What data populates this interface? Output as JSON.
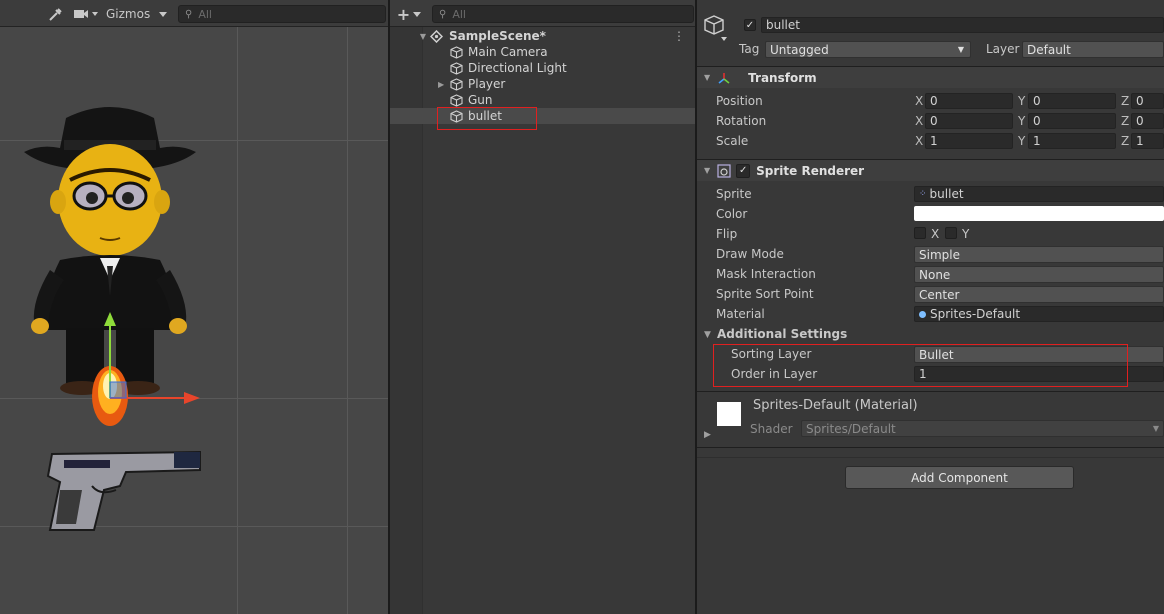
{
  "scene": {
    "gizmos_label": "Gizmos",
    "search_placeholder": "All"
  },
  "hierarchy": {
    "search_placeholder": "All",
    "scene_name": "SampleScene*",
    "items": [
      {
        "label": "Main Camera"
      },
      {
        "label": "Directional Light"
      },
      {
        "label": "Player"
      },
      {
        "label": "Gun"
      },
      {
        "label": "bullet"
      }
    ]
  },
  "inspector": {
    "object_name": "bullet",
    "tag_label": "Tag",
    "tag_value": "Untagged",
    "layer_label": "Layer",
    "layer_value": "Default",
    "transform": {
      "title": "Transform",
      "position_label": "Position",
      "rotation_label": "Rotation",
      "scale_label": "Scale",
      "axis_x": "X",
      "axis_y": "Y",
      "axis_z": "Z",
      "position": {
        "x": "0",
        "y": "0",
        "z": "0"
      },
      "rotation": {
        "x": "0",
        "y": "0",
        "z": "0"
      },
      "scale": {
        "x": "1",
        "y": "1",
        "z": "1"
      }
    },
    "sprite_renderer": {
      "title": "Sprite Renderer",
      "sprite_label": "Sprite",
      "sprite_value": "bullet",
      "color_label": "Color",
      "color_value": "#ffffff",
      "flip_label": "Flip",
      "flip_x": "X",
      "flip_y": "Y",
      "draw_mode_label": "Draw Mode",
      "draw_mode_value": "Simple",
      "mask_label": "Mask Interaction",
      "mask_value": "None",
      "sort_point_label": "Sprite Sort Point",
      "sort_point_value": "Center",
      "material_label": "Material",
      "material_value": "Sprites-Default",
      "additional_title": "Additional Settings",
      "sorting_layer_label": "Sorting Layer",
      "sorting_layer_value": "Bullet",
      "order_label": "Order in Layer",
      "order_value": "1"
    },
    "material": {
      "title": "Sprites-Default (Material)",
      "shader_label": "Shader",
      "shader_value": "Sprites/Default"
    },
    "add_component_label": "Add Component"
  }
}
